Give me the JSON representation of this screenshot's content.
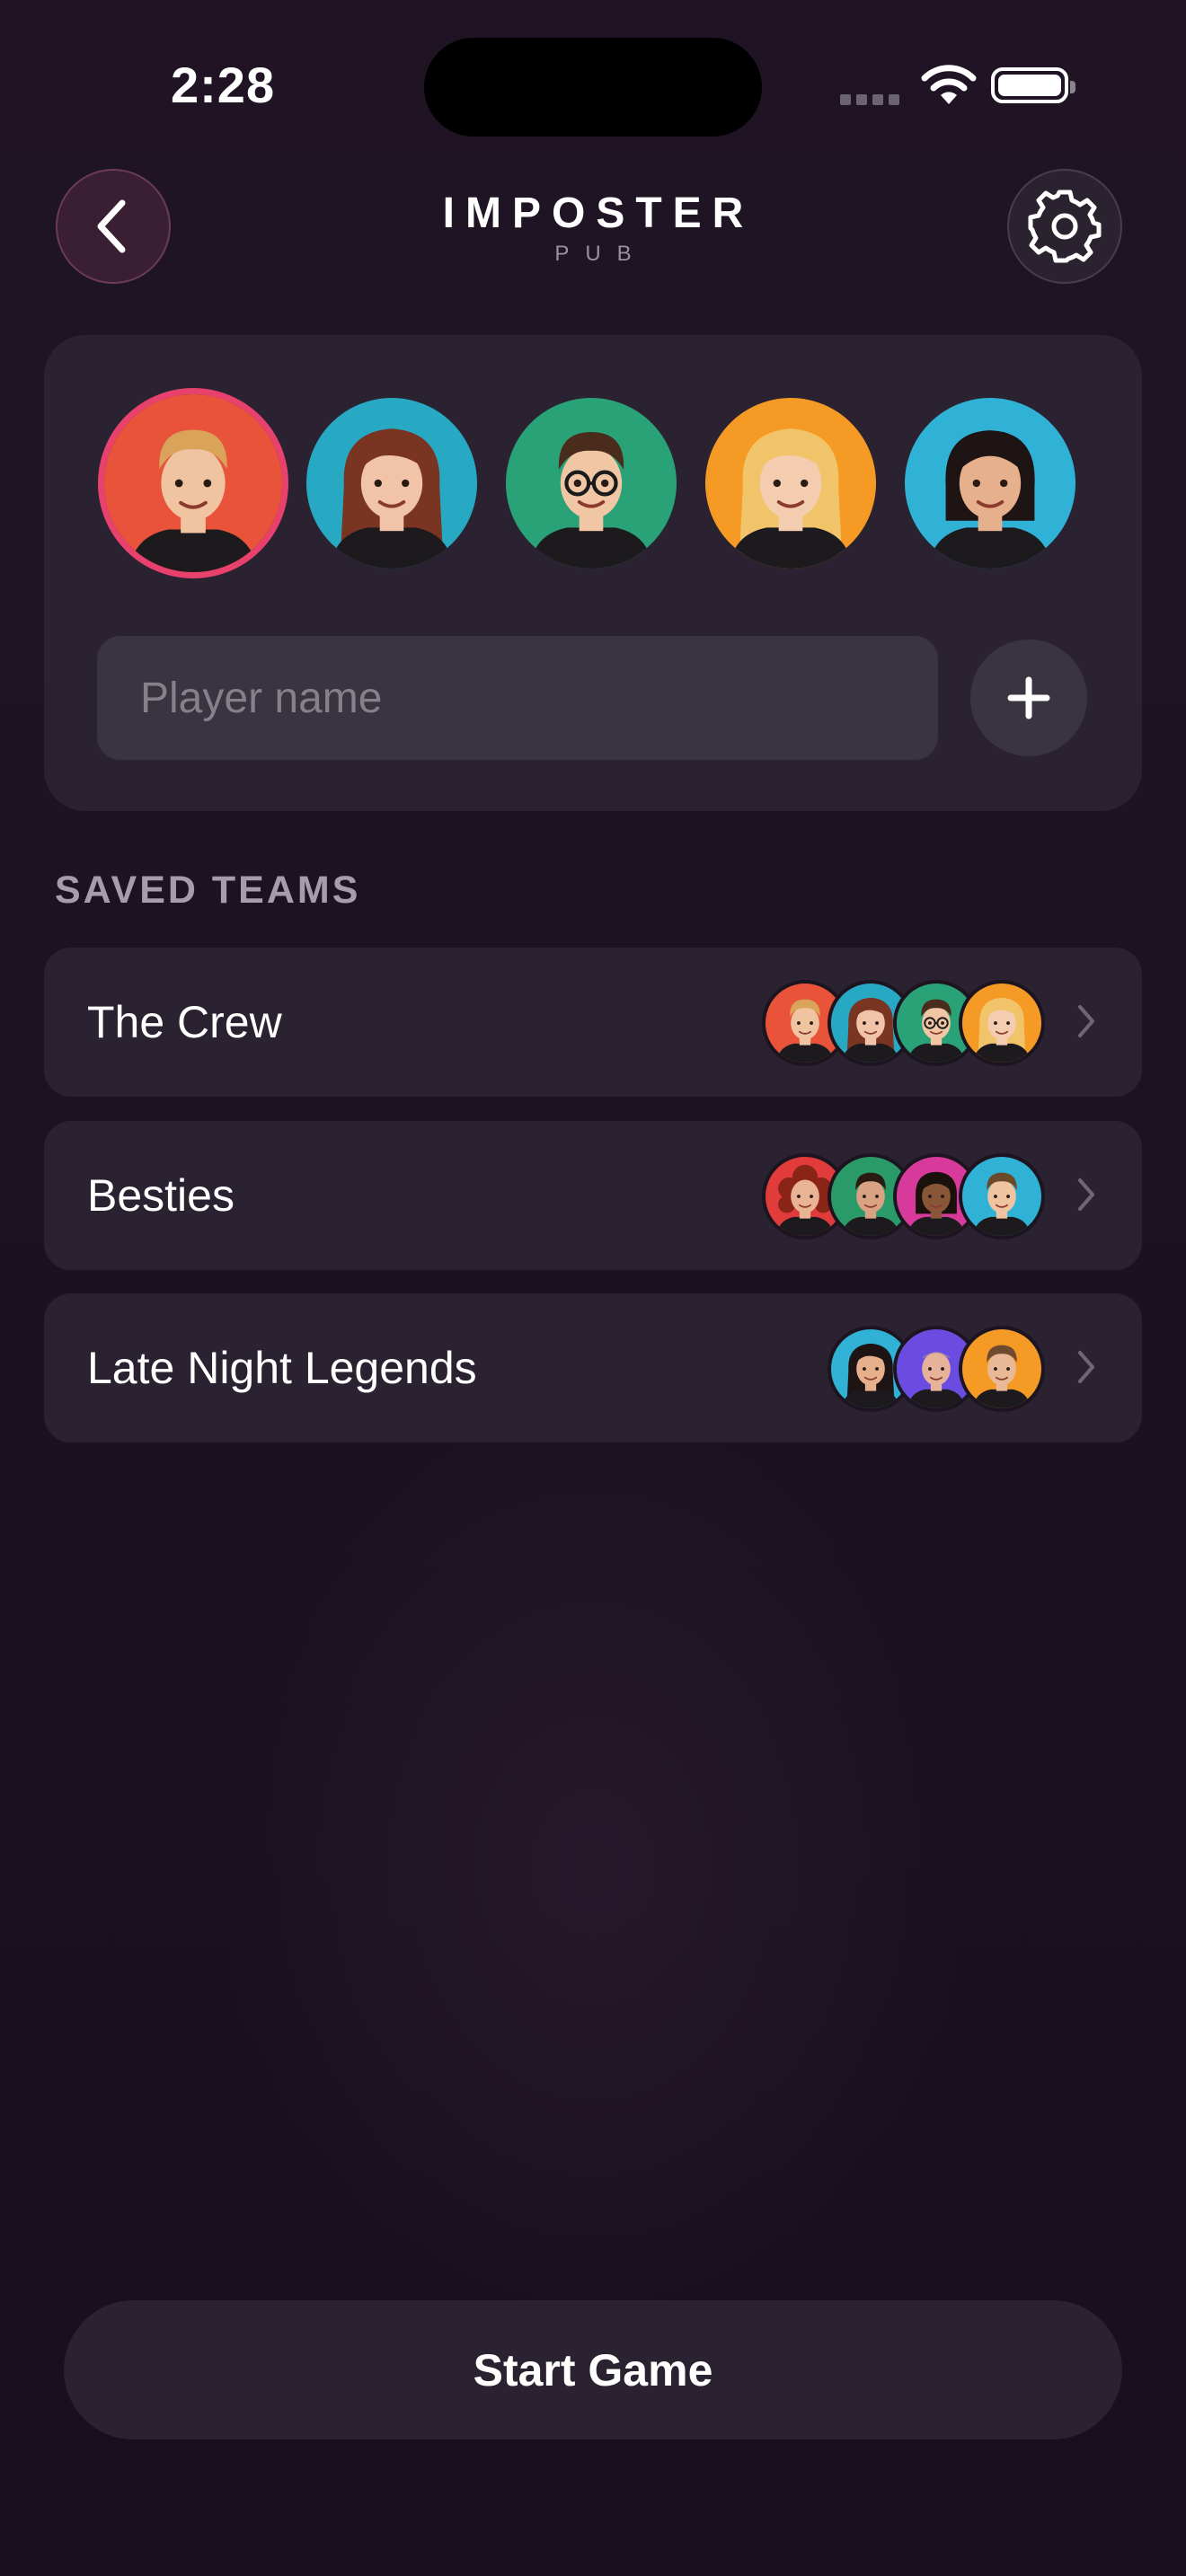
{
  "status_bar": {
    "time": "2:28"
  },
  "header": {
    "title": "IMPOSTER",
    "subtitle": "PUB",
    "back_icon": "chevron-left-icon",
    "settings_icon": "gear-icon"
  },
  "players": {
    "avatars": [
      {
        "name": "player-avatar-1",
        "bg": "#e8533a",
        "skin": "#f0c4a0",
        "hair": "#d9a45a",
        "style": "short",
        "selected": true
      },
      {
        "name": "player-avatar-2",
        "bg": "#27a9c4",
        "skin": "#f1c3a8",
        "hair": "#7a3422",
        "style": "long",
        "selected": false
      },
      {
        "name": "player-avatar-3",
        "bg": "#2aa277",
        "skin": "#f0c6a4",
        "hair": "#4a2c1c",
        "style": "glasses",
        "selected": false
      },
      {
        "name": "player-avatar-4",
        "bg": "#f59a24",
        "skin": "#f4cdb0",
        "hair": "#f1c46a",
        "style": "long",
        "selected": false
      },
      {
        "name": "player-avatar-5",
        "bg": "#2fb2d6",
        "skin": "#e6b08c",
        "hair": "#1e1414",
        "style": "bob",
        "selected": false
      }
    ],
    "input_placeholder": "Player name",
    "add_icon": "plus-icon"
  },
  "saved_teams": {
    "title": "SAVED TEAMS",
    "teams": [
      {
        "name": "The Crew",
        "members": [
          {
            "bg": "#e8533a",
            "skin": "#f0c4a0",
            "hair": "#d9a45a",
            "style": "short"
          },
          {
            "bg": "#27a9c4",
            "skin": "#f1c3a8",
            "hair": "#7a3422",
            "style": "long"
          },
          {
            "bg": "#2aa277",
            "skin": "#f0c6a4",
            "hair": "#4a2c1c",
            "style": "glasses"
          },
          {
            "bg": "#f59a24",
            "skin": "#f4cdb0",
            "hair": "#f1c46a",
            "style": "long"
          }
        ]
      },
      {
        "name": "Besties",
        "members": [
          {
            "bg": "#e23b3b",
            "skin": "#e9b493",
            "hair": "#8a2416",
            "style": "curly"
          },
          {
            "bg": "#2a9a68",
            "skin": "#d9a283",
            "hair": "#2a1a12",
            "style": "short"
          },
          {
            "bg": "#d83a9c",
            "skin": "#8a5638",
            "hair": "#1a100c",
            "style": "bob"
          },
          {
            "bg": "#2fb2d6",
            "skin": "#f0c4a0",
            "hair": "#6b4a2a",
            "style": "short"
          }
        ]
      },
      {
        "name": "Late Night Legends",
        "members": [
          {
            "bg": "#2fb2d6",
            "skin": "#e6b08c",
            "hair": "#1e1414",
            "style": "long"
          },
          {
            "bg": "#6a4ce0",
            "skin": "#e6b29a",
            "hair": "#b9a090",
            "style": "bald"
          },
          {
            "bg": "#f59a24",
            "skin": "#e9b896",
            "hair": "#6e4a2e",
            "style": "short"
          }
        ]
      }
    ],
    "chevron_icon": "chevron-right-icon"
  },
  "start_button": {
    "label": "Start Game"
  },
  "colors": {
    "accent": "#e8416d",
    "card": "#2a2230",
    "background": "#1c1321"
  }
}
